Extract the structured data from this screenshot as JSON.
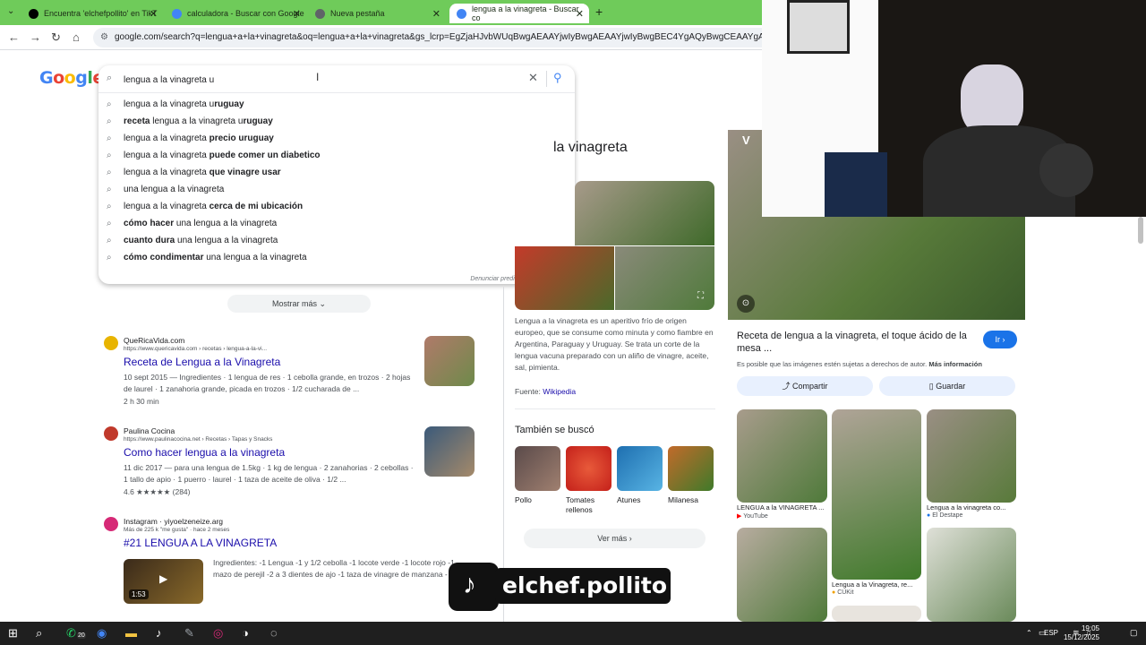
{
  "tabs": [
    {
      "title": "Encuentra 'elchefpollito' en TikT",
      "favicon": "tiktok-icon",
      "color": "#000000"
    },
    {
      "title": "calculadora - Buscar con Google",
      "favicon": "google-icon",
      "color": "#4285f4"
    },
    {
      "title": "Nueva pestaña",
      "favicon": "chrome-icon",
      "color": "#5f6368"
    },
    {
      "title": "lengua a la vinagreta - Buscar co",
      "favicon": "google-icon",
      "color": "#4285f4"
    }
  ],
  "omnibox": {
    "url": "google.com/search?q=lengua+a+la+vinagreta&oq=lengua+a+la+vinagreta&gs_lcrp=EgZjaHJvbWUqBwgAEAAYjwIyBwgAEAAYjwIyBwgBEC4YgAQyBwgCEAAYgAQyBwgDEAAYgAQ"
  },
  "logo": "Google",
  "search": {
    "query": "lengua a la vinagreta u",
    "suggestions": [
      {
        "plain": "lengua a la vinagreta u",
        "bold": "ruguay"
      },
      {
        "bold_pre": "receta",
        "plain": " lengua a la vinagreta u",
        "bold": "ruguay"
      },
      {
        "plain": "lengua a la vinagreta ",
        "bold": "precio uruguay"
      },
      {
        "plain": "lengua a la vinagreta ",
        "bold": "puede comer un diabetico"
      },
      {
        "plain": "lengua a la vinagreta ",
        "bold": "que vinagre usar"
      },
      {
        "plain": "una lengua a la vinagreta",
        "bold": ""
      },
      {
        "plain": "lengua a la vinagreta ",
        "bold": "cerca de mi ubicación"
      },
      {
        "bold_pre": "cómo hacer",
        "plain": " una lengua a la vinagreta",
        "bold": ""
      },
      {
        "bold_pre": "cuanto dura",
        "plain": " una lengua a la vinagreta",
        "bold": ""
      },
      {
        "bold_pre": "cómo condimentar",
        "plain": " una lengua a la vinagreta",
        "bold": ""
      }
    ],
    "report": "Denunciar predicciones ofensivas"
  },
  "mostrar_mas": "Mostrar más",
  "results": [
    {
      "site": "QueRicaVida.com",
      "url": "https://www.quericavida.com › recetas › lengua-a-la-vi...",
      "title": "Receta de Lengua a la Vinagreta",
      "snippet": "10 sept 2015 — Ingredientes · 1 lengua de res · 1 cebolla grande, en trozos · 2 hojas de laurel · 1 zanahoria grande, picada en trozos · 1/2 cucharada de ...",
      "extra": "2 h 30 min",
      "favicon_color": "#e8b400"
    },
    {
      "site": "Paulina Cocina",
      "url": "https://www.paulinacocina.net › Recetas › Tapas y Snacks",
      "title": "Como hacer lengua a la vinagreta",
      "snippet": "11 dic 2017 — para una lengua de 1.5kg · 1 kg de lengua · 2 zanahorias · 2 cebollas · 1 tallo de apio · 1 puerro · laurel · 1 taza de aceite de oliva · 1/2 ...",
      "extra": "4.6 ★★★★★ (284)",
      "favicon_color": "#c0392b"
    },
    {
      "site": "Instagram · yiyoelzeneize.arg",
      "url": "Más de 225 k \"me gusta\" · hace 2 meses",
      "title": "#21 LENGUA A LA VINAGRETA",
      "snippet": "Ingredientes: -1 Lengua -1 y 1/2 cebolla -1 locote verde -1 locote rojo -1 mazo de perejil -2 a 3 dientes de ajo -1 taza de vinagre de manzana -",
      "extra": "1:53",
      "favicon_color": "#d62976"
    }
  ],
  "knowledge_panel": {
    "title": "la vinagreta",
    "description": "Lengua a la vinagreta es un aperitivo frío de origen europeo, que se consume como minuta y como fiambre en Argentina, Paraguay y Uruguay. Se trata un corte de la lengua vacuna preparado con un aliño de vinagre, aceite, sal, pimienta.",
    "source_label": "Fuente:",
    "source": "Wikipedia",
    "also_title": "También se buscó",
    "also": [
      {
        "label": "Pollo",
        "color": "#8a6a5a"
      },
      {
        "label": "Tomates rellenos",
        "color": "#d9452f"
      },
      {
        "label": "Atunes",
        "color": "#2e8fc9"
      },
      {
        "label": "Milanesa",
        "color": "#6a8a3a"
      }
    ],
    "ver_mas": "Ver más"
  },
  "viewer": {
    "title": "Receta de lengua a la vinagreta, el toque ácido de la mesa ...",
    "go": "Ir",
    "rights": "Es posible que las imágenes estén sujetas a derechos de autor.",
    "rights_link": "Más información",
    "share": "Compartir",
    "save": "Guardar",
    "grid": [
      {
        "caption": "LENGUA a la VINAGRETA ...",
        "source": "YouTube"
      },
      {
        "caption": "Lengua a la Vinagreta, re...",
        "source": "CUKit"
      },
      {
        "caption": "Lengua a la vinagreta co...",
        "source": "El Destape"
      }
    ]
  },
  "watermark": "elchef.pollito",
  "taskbar": {
    "badge": "20",
    "lang": "ESP",
    "time": "19:05",
    "date": "15/12/2025"
  }
}
